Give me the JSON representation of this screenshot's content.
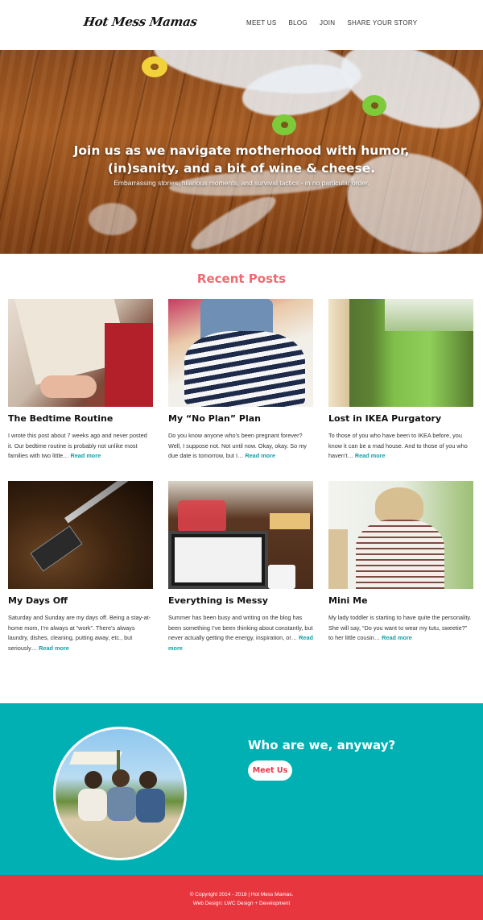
{
  "header": {
    "logo": "Hot Mess Mamas",
    "nav": [
      "MEET US",
      "BLOG",
      "JOIN",
      "SHARE YOUR STORY"
    ]
  },
  "hero": {
    "title_line1": "Join us as we navigate motherhood with humor,",
    "title_line2": "(in)sanity, and a bit of wine & cheese.",
    "subtitle": "Embarrassing stories, hilarious moments, and survival tactics - in no particular order."
  },
  "recent": {
    "heading": "Recent Posts",
    "read_more": "Read more",
    "posts": [
      {
        "title": "The Bedtime Routine",
        "excerpt": "I wrote this post about 7 weeks ago and never posted it.   Our bedtime routine is probably not unlike most families with two little…"
      },
      {
        "title": "My “No Plan” Plan",
        "excerpt": "Do you know anyone who’s been pregnant forever?  Well, I suppose not.  Not until now.  Okay, okay. So my due date is tomorrow, but I…"
      },
      {
        "title": "Lost in IKEA Purgatory",
        "excerpt": "To those of you who have been to IKEA before, you know it can be a mad house. And to those of you who haven’t…"
      },
      {
        "title": "My Days Off",
        "excerpt": "Saturday and Sunday are my days off.  Being a stay-at-home mom, I’m always at “work”.  There’s always laundry, dishes, cleaning, putting away, etc., but seriously…"
      },
      {
        "title": "Everything is Messy",
        "excerpt": "Summer has been busy and writing on the blog has been something I’ve been thinking about constantly, but never actually getting the energy, inspiration, or…"
      },
      {
        "title": "Mini Me",
        "excerpt": "My lady toddler is starting to have quite the personality. She will say, “Do you want to wear my tutu, sweetie?” to her little cousin…"
      }
    ]
  },
  "about": {
    "title": "Who are we, anyway?",
    "button": "Meet Us"
  },
  "footer": {
    "copyright": "© Copyright 2014 - 2018 | Hot Mess Mamas.",
    "credit": "Web Design: LWC Design + Development"
  },
  "colors": {
    "accent_pink": "#f06a72",
    "teal": "#00b0b2",
    "footer_red": "#e8363f",
    "link_teal": "#0f9fa5"
  }
}
